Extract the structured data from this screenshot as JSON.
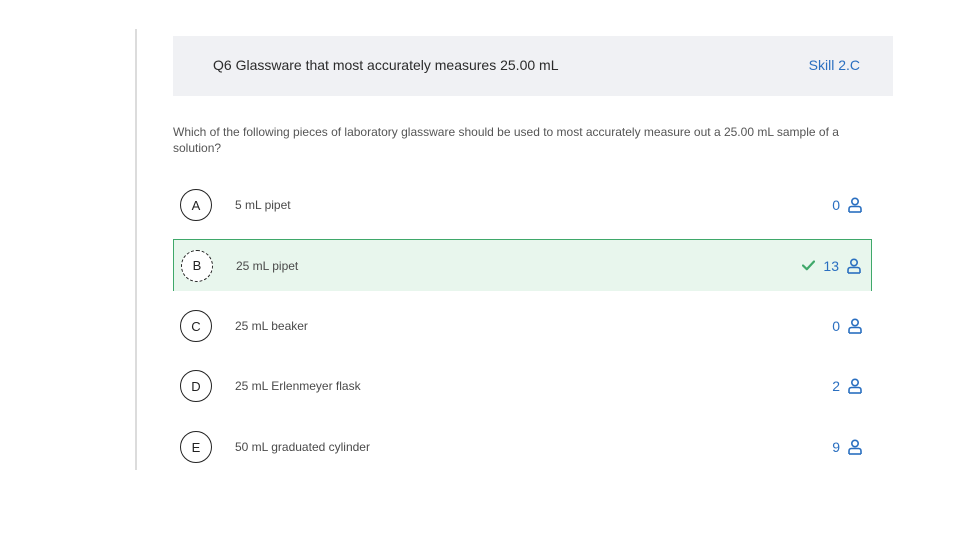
{
  "question": {
    "title": "Q6 Glassware that most accurately measures 25.00 mL",
    "skill": "Skill 2.C",
    "prompt": "Which of the following pieces of laboratory glassware should be used to most accurately measure out a 25.00 mL sample of a solution?"
  },
  "choices": [
    {
      "letter": "A",
      "text": "5 mL pipet",
      "count": "0",
      "correct": false
    },
    {
      "letter": "B",
      "text": "25 mL pipet",
      "count": "13",
      "correct": true
    },
    {
      "letter": "C",
      "text": "25 mL beaker",
      "count": "0",
      "correct": false
    },
    {
      "letter": "D",
      "text": "25 mL Erlenmeyer flask",
      "count": "2",
      "correct": false
    },
    {
      "letter": "E",
      "text": "50 mL graduated cylinder",
      "count": "9",
      "correct": false
    }
  ],
  "icons": {
    "respondents": "user-icon",
    "correct_marker": "check-icon"
  },
  "colors": {
    "accent": "#2a6fc0",
    "correct_border": "#3fa86a",
    "correct_fill": "#e8f6ed",
    "header_band": "#f0f1f4"
  }
}
